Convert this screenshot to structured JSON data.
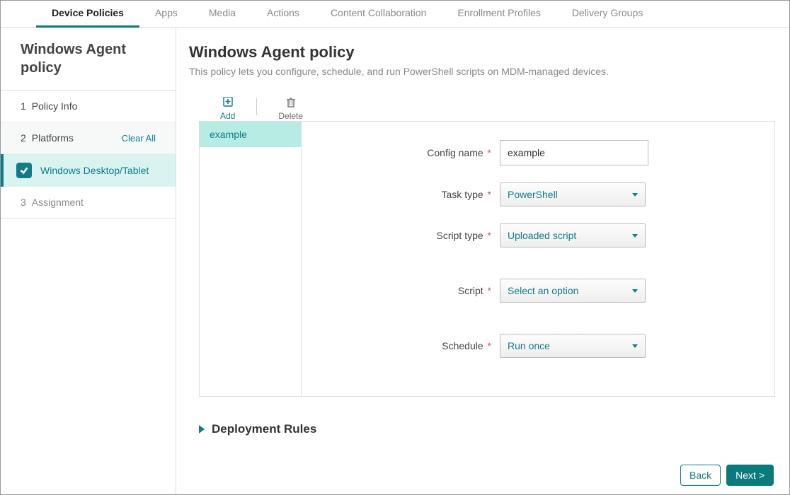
{
  "topnav": {
    "items": [
      {
        "label": "Device Policies",
        "active": true
      },
      {
        "label": "Apps"
      },
      {
        "label": "Media"
      },
      {
        "label": "Actions"
      },
      {
        "label": "Content Collaboration"
      },
      {
        "label": "Enrollment Profiles"
      },
      {
        "label": "Delivery Groups"
      }
    ]
  },
  "sidebar": {
    "title": "Windows Agent policy",
    "steps": {
      "s1": {
        "num": "1",
        "label": "Policy Info"
      },
      "s2": {
        "num": "2",
        "label": "Platforms",
        "clear": "Clear All"
      },
      "platform": {
        "label": "Windows Desktop/Tablet"
      },
      "s3": {
        "num": "3",
        "label": "Assignment"
      }
    }
  },
  "page": {
    "title": "Windows Agent policy",
    "description": "This policy lets you configure, schedule, and run PowerShell scripts on MDM-managed devices."
  },
  "toolbar": {
    "add_label": "Add",
    "delete_label": "Delete"
  },
  "configs": {
    "list": [
      {
        "name": "example"
      }
    ]
  },
  "form": {
    "config_name": {
      "label": "Config name",
      "value": "example"
    },
    "task_type": {
      "label": "Task type",
      "value": "PowerShell"
    },
    "script_type": {
      "label": "Script type",
      "value": "Uploaded script"
    },
    "script": {
      "label": "Script",
      "value": "Select an option"
    },
    "schedule": {
      "label": "Schedule",
      "value": "Run once"
    }
  },
  "deployment": {
    "title": "Deployment Rules"
  },
  "footer": {
    "back": "Back",
    "next": "Next >"
  }
}
